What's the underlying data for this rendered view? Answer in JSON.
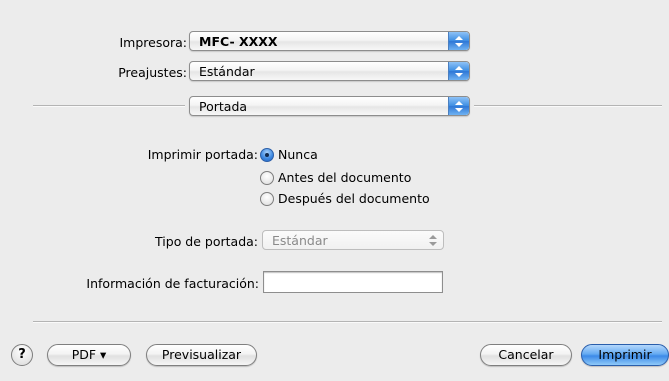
{
  "printer": {
    "label": "Impresora:",
    "value": "MFC- XXXX"
  },
  "presets": {
    "label": "Preajustes:",
    "value": "Estándar"
  },
  "panel": {
    "value": "Portada"
  },
  "print_cover": {
    "label": "Imprimir portada:",
    "options": [
      "Nunca",
      "Antes del documento",
      "Después del documento"
    ],
    "selected": "Nunca"
  },
  "cover_type": {
    "label": "Tipo de portada:",
    "value": "Estándar"
  },
  "billing": {
    "label": "Información de facturación:",
    "value": ""
  },
  "footer": {
    "help_label": "?",
    "pdf_label": "PDF ▾",
    "preview_label": "Previsualizar",
    "cancel_label": "Cancelar",
    "print_label": "Imprimir"
  }
}
